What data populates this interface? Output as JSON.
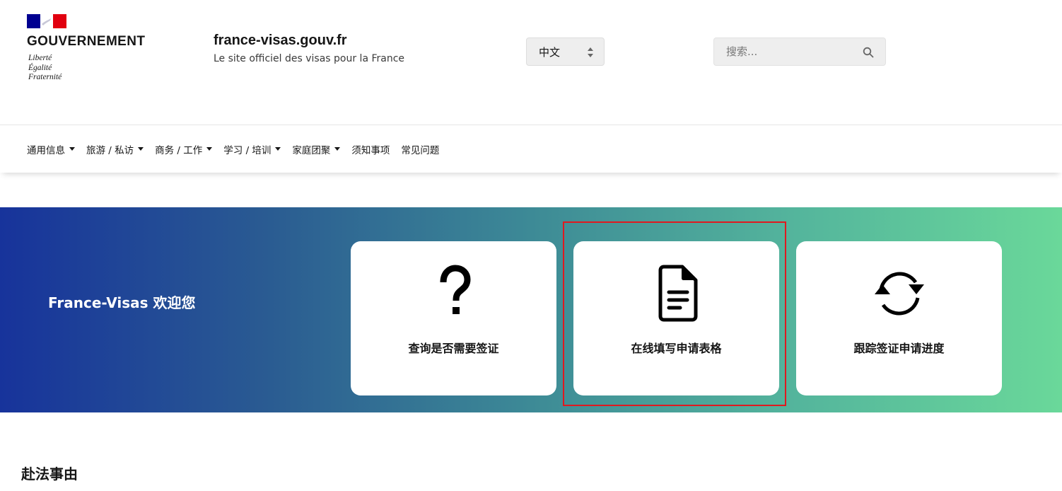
{
  "header": {
    "gov_name": "GOUVERNEMENT",
    "motto": [
      "Liberté",
      "Égalité",
      "Fraternité"
    ],
    "site_title": "france-visas.gouv.fr",
    "site_tagline": "Le site officiel des visas pour la France",
    "language_select": {
      "value": "中文"
    },
    "search": {
      "placeholder": "搜索..."
    }
  },
  "nav": {
    "items": [
      {
        "label": "通用信息",
        "dropdown": true
      },
      {
        "label": "旅游 / 私访",
        "dropdown": true
      },
      {
        "label": "商务 / 工作",
        "dropdown": true
      },
      {
        "label": "学习 / 培训",
        "dropdown": true
      },
      {
        "label": "家庭团聚",
        "dropdown": true
      },
      {
        "label": "须知事项",
        "dropdown": false
      },
      {
        "label": "常见问题",
        "dropdown": false
      }
    ]
  },
  "hero": {
    "title": "France-Visas 欢迎您",
    "cards": [
      {
        "label": "查询是否需要签证",
        "icon": "question-mark-icon"
      },
      {
        "label": "在线填写申请表格",
        "icon": "document-icon"
      },
      {
        "label": "跟踪签证申请进度",
        "icon": "refresh-cycle-icon"
      }
    ]
  },
  "section": {
    "title": "赴法事由"
  },
  "colors": {
    "flag_blue": "#000091",
    "flag_red": "#e1000f",
    "gradient_start": "#17339b",
    "gradient_end": "#6ad89a",
    "highlight_border": "#e0191f"
  }
}
